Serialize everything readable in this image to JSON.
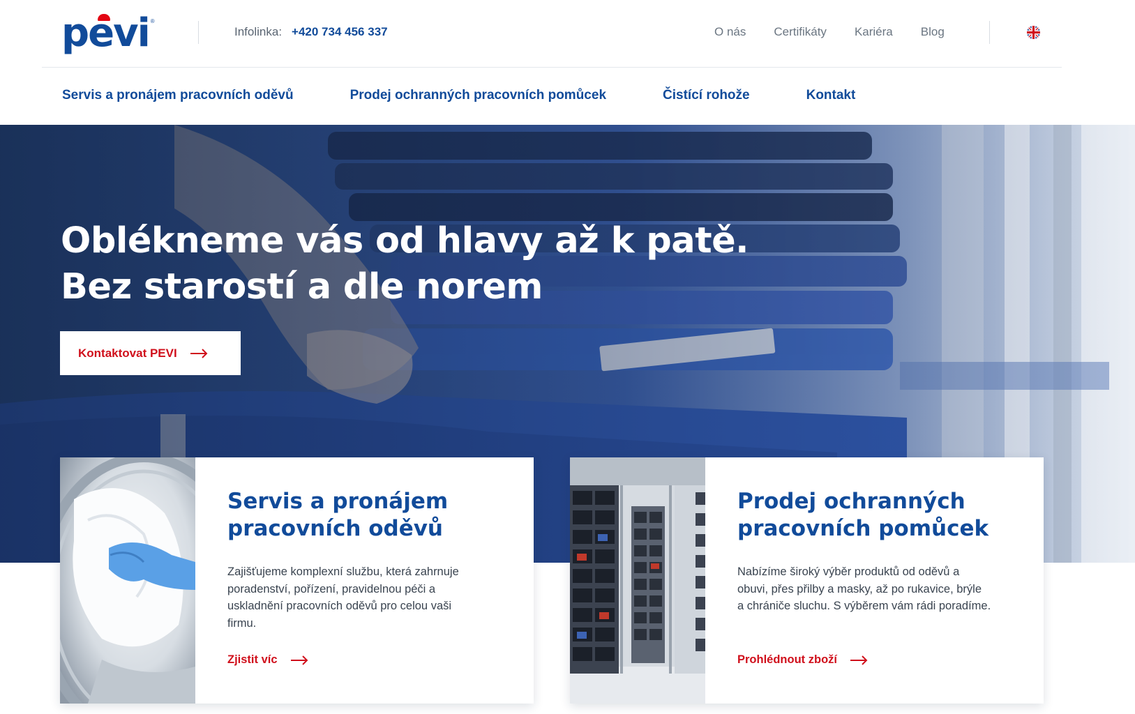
{
  "header": {
    "logo_text": "pevi",
    "logo_reg": "®",
    "infoline_label": "Infolinka:",
    "infoline_phone": "+420 734 456 337",
    "top_nav": [
      "O nás",
      "Certifikáty",
      "Kariéra",
      "Blog"
    ],
    "language_icon": "uk-flag-icon"
  },
  "main_nav": [
    "Servis a pronájem pracovních oděvů",
    "Prodej ochranných pracovních pomůcek",
    "Čistící rohože",
    "Kontakt"
  ],
  "hero": {
    "title_line1": "Oblékneme vás od hlavy až k patě.",
    "title_line2": "Bez starostí a dle norem",
    "cta_label": "Kontaktovat PEVI"
  },
  "cards": [
    {
      "title_line1": "Servis a pronájem",
      "title_line2": "pracovních oděvů",
      "text_lines": [
        "Zajišťujeme komplexní službu, která zahrnuje",
        "poradenství, pořízení, pravidelnou péči a",
        "uskladnění pracovních oděvů pro celou vaši",
        "firmu."
      ],
      "link_label": "Zjistit víc"
    },
    {
      "title_line1": "Prodej ochranných",
      "title_line2": "pracovních pomůcek",
      "text_lines": [
        "Nabízíme široký výběr produktů od oděvů a",
        "obuvi, přes přilby a masky, až po rukavice, brýle",
        "a chrániče sluchu. S výběrem vám rádi poradíme."
      ],
      "link_label": "Prohlédnout zboží"
    }
  ],
  "colors": {
    "brand_blue": "#114b9a",
    "accent_red": "#d0101c"
  }
}
